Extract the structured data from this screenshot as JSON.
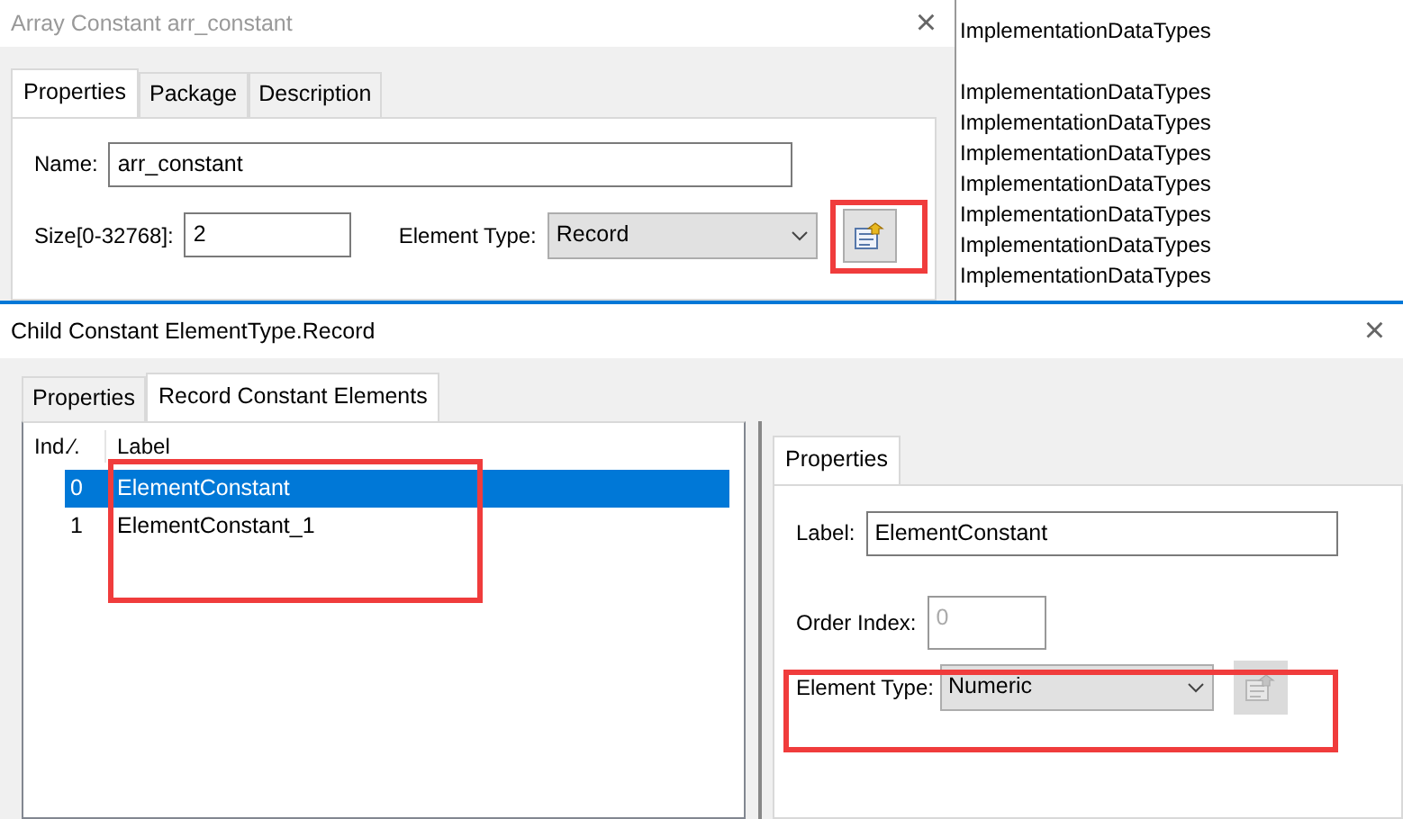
{
  "back_dialog": {
    "title": "Array Constant arr_constant",
    "close": "×",
    "tabs": [
      {
        "label": "Properties",
        "selected": true
      },
      {
        "label": "Package",
        "selected": false
      },
      {
        "label": "Description",
        "selected": false
      }
    ],
    "name": {
      "label": "Name:",
      "value": "arr_constant"
    },
    "size": {
      "label": "Size[0-32768]:",
      "value": "2"
    },
    "element_type": {
      "label": "Element Type:",
      "value": "Record",
      "edit_disabled": false
    }
  },
  "background_list": {
    "groups": [
      [
        "ImplementationDataTypes"
      ],
      [
        "ImplementationDataTypes",
        "ImplementationDataTypes",
        "ImplementationDataTypes",
        "ImplementationDataTypes",
        "ImplementationDataTypes",
        "ImplementationDataTypes",
        "ImplementationDataTypes"
      ]
    ]
  },
  "front_dialog": {
    "title": "Child Constant ElementType.Record",
    "close": "×",
    "tabs": [
      {
        "label": "Properties",
        "selected": false
      },
      {
        "label": "Record Constant Elements",
        "selected": true
      }
    ],
    "list": {
      "columns": [
        "Ind.⁄.",
        "Label"
      ],
      "rows": [
        {
          "index": "0",
          "label": "ElementConstant",
          "selected": true
        },
        {
          "index": "1",
          "label": "ElementConstant_1",
          "selected": false
        }
      ]
    },
    "properties": {
      "tab": "Properties",
      "label": {
        "label": "Label:",
        "value": "ElementConstant"
      },
      "order_index": {
        "label": "Order Index:",
        "value": "0",
        "disabled": true
      },
      "element_type": {
        "label": "Element Type:",
        "value": "Numeric",
        "edit_disabled": true
      }
    }
  },
  "highlights": [
    {
      "kind": "outline"
    },
    {
      "kind": "outline"
    },
    {
      "kind": "outline"
    }
  ]
}
